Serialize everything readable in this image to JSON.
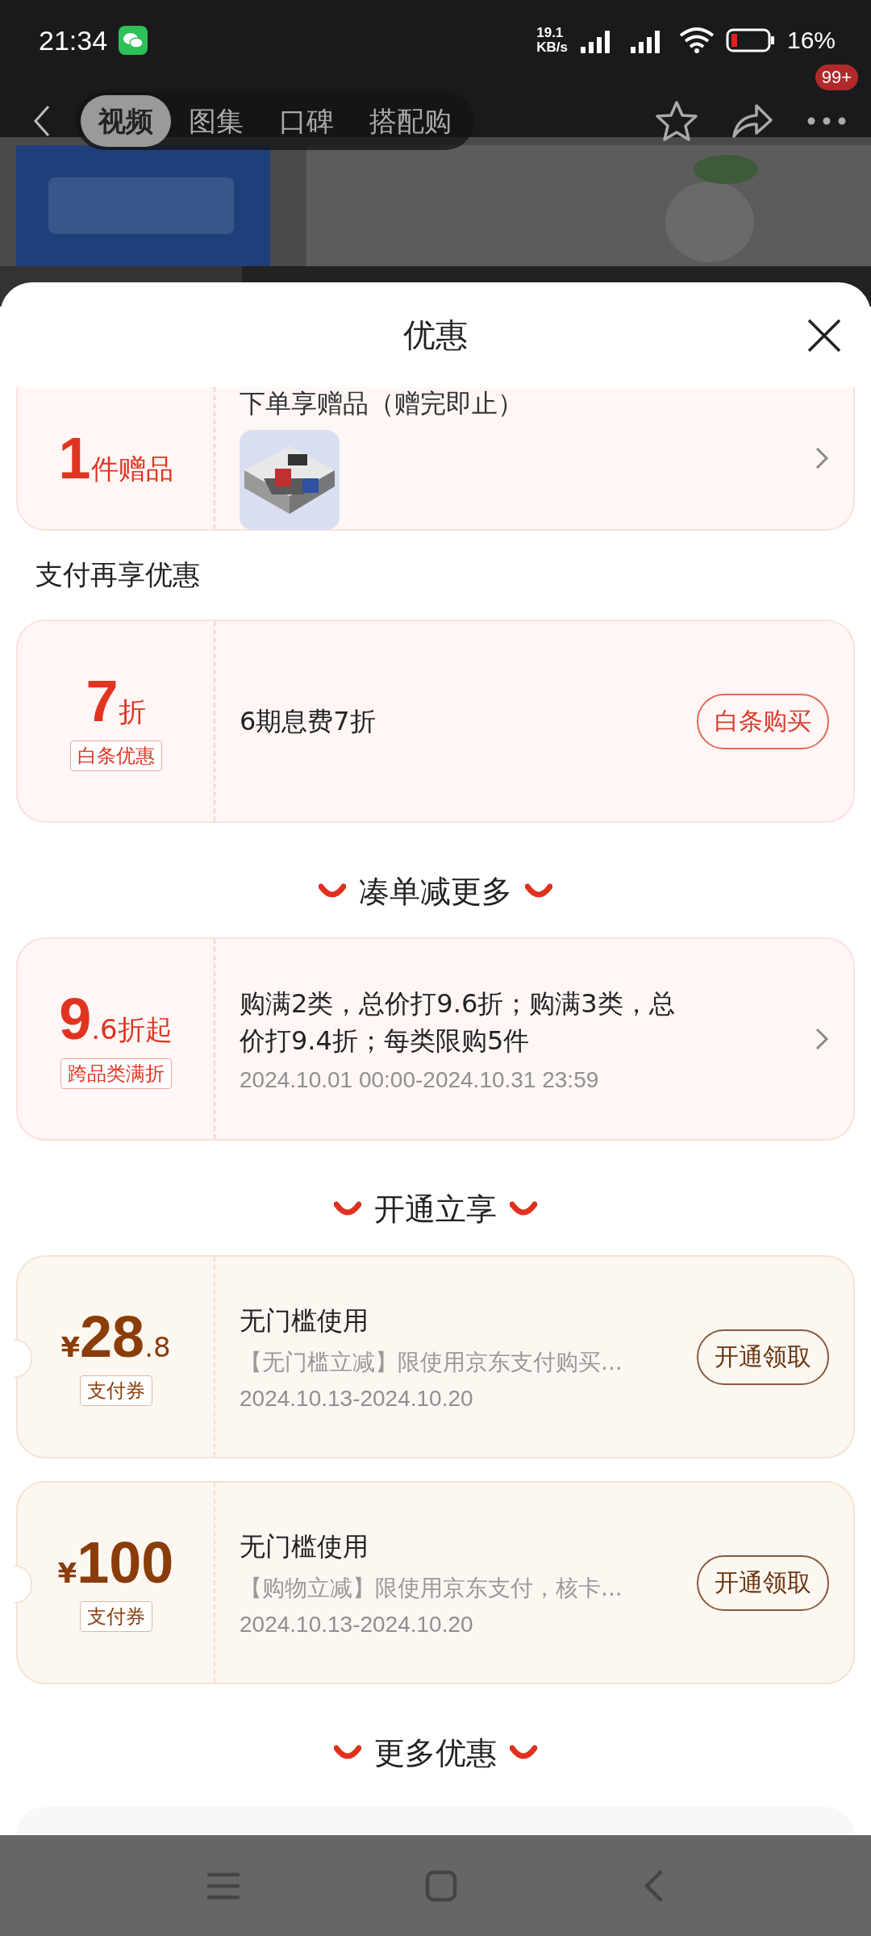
{
  "status_bar": {
    "time": "21:34",
    "speed_value": "19.1",
    "speed_unit": "KB/s",
    "battery": "16%"
  },
  "nav": {
    "tabs": [
      {
        "label": "视频",
        "selected": true
      },
      {
        "label": "图集",
        "selected": false
      },
      {
        "label": "口碑",
        "selected": false
      },
      {
        "label": "搭配购",
        "selected": false
      }
    ],
    "badge": "99+"
  },
  "sheet": {
    "title": "优惠"
  },
  "items": [
    {
      "kind": "gift",
      "value": "1",
      "unit": "件赠品",
      "title": "下单享赠品（赠完即止）"
    },
    {
      "kind": "label",
      "text": "支付再享优惠"
    },
    {
      "kind": "card",
      "color": "#e03421",
      "notched": false,
      "value_big": "7",
      "value_small": "折",
      "tag": "白条优惠",
      "title": "6期息费7折",
      "action": {
        "kind": "button",
        "label": "白条购买"
      }
    },
    {
      "kind": "heading",
      "text": "凑单减更多"
    },
    {
      "kind": "card",
      "color": "#e03421",
      "notched": false,
      "value_big": "9",
      "value_small": ".6折起",
      "tag": "跨品类满折",
      "title": "购满2类，总价打9.6折；购满3类，总价打9.4折；每类限购5件",
      "date": "2024.10.01 00:00-2024.10.31 23:59",
      "action": {
        "kind": "chevron"
      }
    },
    {
      "kind": "heading",
      "text": "开通立享"
    },
    {
      "kind": "card",
      "color": "#8a3d0a",
      "notched": true,
      "prefix": "¥",
      "value_big": "28",
      "value_small": ".8",
      "tag": "支付券",
      "title": "无门槛使用",
      "desc": "【无门槛立减】限使用京东支付购买...",
      "date": "2024.10.13-2024.10.20",
      "action": {
        "kind": "button",
        "label": "开通领取"
      }
    },
    {
      "kind": "card",
      "color": "#8a3d0a",
      "notched": true,
      "prefix": "¥",
      "value_big": "100",
      "tag": "支付券",
      "title": "无门槛使用",
      "desc": "【购物立减】限使用京东支付，核卡...",
      "date": "2024.10.13-2024.10.20",
      "action": {
        "kind": "button",
        "label": "开通领取"
      }
    },
    {
      "kind": "heading",
      "text": "更多优惠"
    },
    {
      "kind": "stub"
    }
  ]
}
